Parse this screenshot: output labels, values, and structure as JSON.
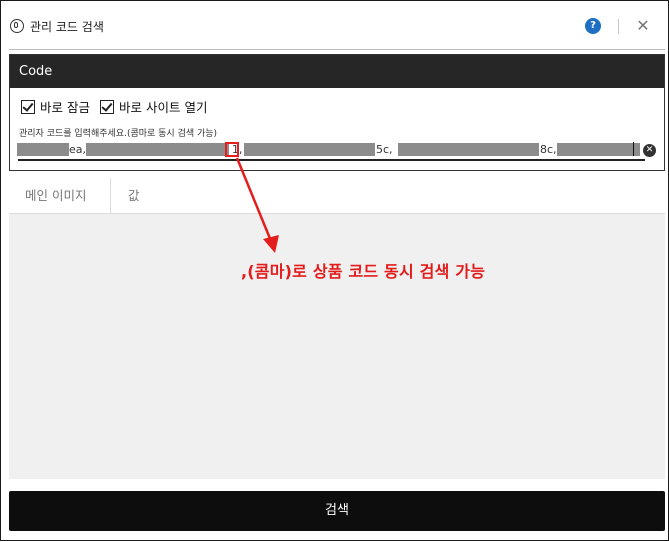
{
  "window": {
    "title": "관리 코드 검색"
  },
  "panel": {
    "header": "Code",
    "checkbox_lock": {
      "label": "바로 잠금",
      "checked": true
    },
    "checkbox_open": {
      "label": "바로 사이트 열기",
      "checked": true
    },
    "hint": "관리자 코드를 입력해주세요.(콤마로 동시 검색 가능)",
    "input_fragments": [
      "ea,",
      "1,",
      "5c,",
      "8c,"
    ]
  },
  "table": {
    "columns": [
      "메인 이미지",
      "값"
    ]
  },
  "annotation": ",(콤마)로 상품 코드 동시 검색 가능",
  "search_button": "검색",
  "icons": {
    "app": "app-icon",
    "help": "help-icon",
    "close": "close-icon",
    "clear": "clear-input-icon",
    "check": "checkmark-icon"
  },
  "help_glyph": "?",
  "close_glyph": "✕",
  "clear_glyph": "✕",
  "colors": {
    "annotation": "#e31b1b",
    "header_bg": "#262626",
    "help": "#1e6fc4"
  }
}
